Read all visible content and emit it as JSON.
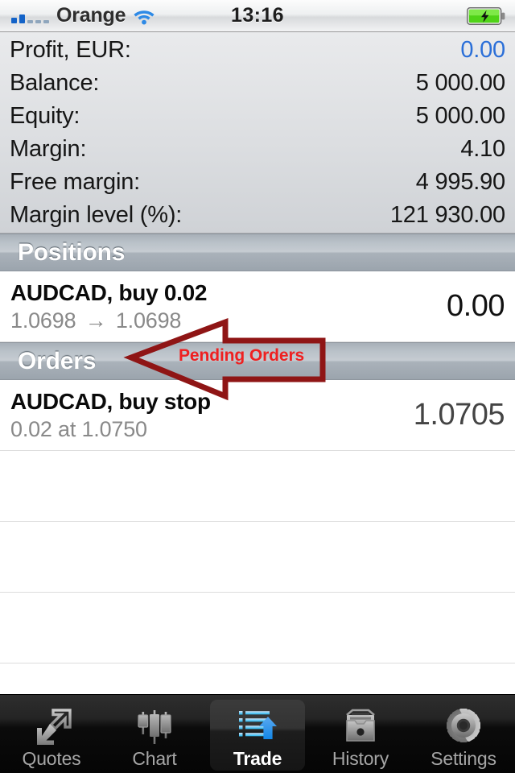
{
  "statusbar": {
    "carrier": "Orange",
    "time": "13:16",
    "signal_bars_filled": 2,
    "signal_bars_total": 5,
    "wifi_icon": "wifi-icon",
    "battery_icon": "battery-charging-icon",
    "battery_color": "#4fd317"
  },
  "summary": {
    "rows": [
      {
        "label": "Profit, EUR:",
        "value": "0.00",
        "accent": true
      },
      {
        "label": "Balance:",
        "value": "5 000.00",
        "accent": false
      },
      {
        "label": "Equity:",
        "value": "5 000.00",
        "accent": false
      },
      {
        "label": "Margin:",
        "value": "4.10",
        "accent": false
      },
      {
        "label": "Free margin:",
        "value": "4 995.90",
        "accent": false
      },
      {
        "label": "Margin level (%):",
        "value": "121 930.00",
        "accent": false
      }
    ],
    "profit_color": "#2b6fd8"
  },
  "positions": {
    "header": "Positions",
    "rows": [
      {
        "symbol": "AUDCAD, buy 0.02",
        "open_price": "1.0698",
        "arrow": "→",
        "current_price": "1.0698",
        "value": "0.00"
      }
    ]
  },
  "orders": {
    "header": "Orders",
    "rows": [
      {
        "symbol": "AUDCAD, buy stop",
        "detail": "0.02 at 1.0750",
        "value": "1.0705"
      }
    ]
  },
  "annotation": {
    "label": "Pending Orders",
    "color": "#8f1515",
    "text_color": "#ef2020"
  },
  "empty_rows": 4,
  "tabbar": {
    "items": [
      {
        "label": "Quotes",
        "icon": "two-arrows-diagonal-icon",
        "active": false
      },
      {
        "label": "Chart",
        "icon": "candlestick-chart-icon",
        "active": false
      },
      {
        "label": "Trade",
        "icon": "list-with-up-arrow-icon",
        "active": true
      },
      {
        "label": "History",
        "icon": "archive-box-icon",
        "active": false
      },
      {
        "label": "Settings",
        "icon": "gear-icon",
        "active": false
      }
    ]
  }
}
